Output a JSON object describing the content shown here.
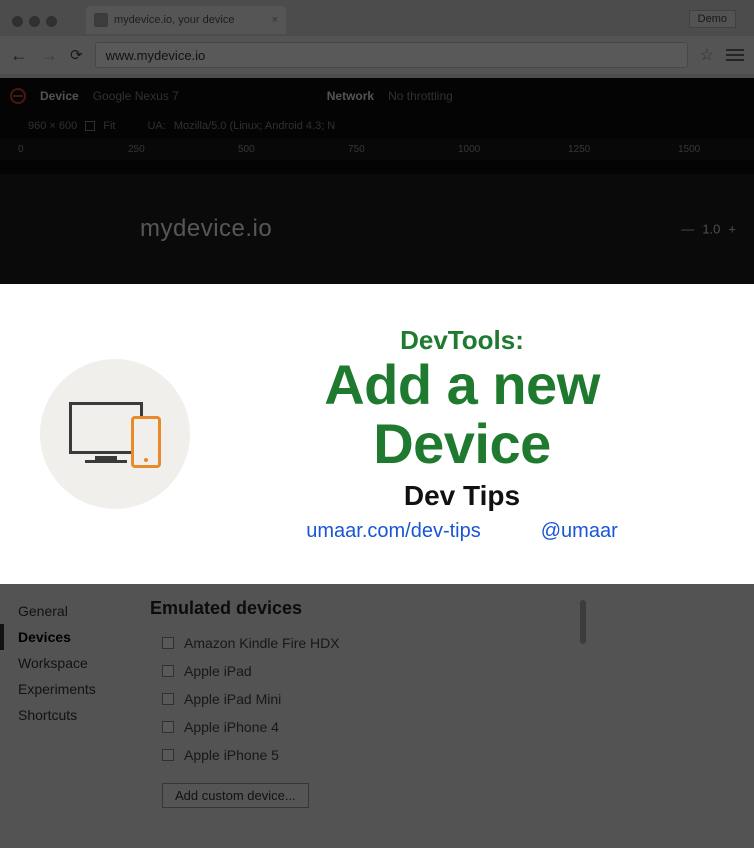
{
  "browser": {
    "tab_title": "mydevice.io, your device",
    "demo_label": "Demo",
    "url": "www.mydevice.io"
  },
  "dev_toolbar": {
    "device_label": "Device",
    "device_value": "Google Nexus 7",
    "network_label": "Network",
    "network_value": "No throttling",
    "dims": "960 × 600",
    "fit_label": "Fit",
    "ua_prefix": "UA:",
    "ua_value": "Mozilla/5.0 (Linux; Android 4.3; N",
    "ruler": [
      "0",
      "250",
      "500",
      "750",
      "1000",
      "1250",
      "1500"
    ]
  },
  "site": {
    "host": "mydevice.io",
    "zoom": "1.0"
  },
  "card": {
    "kicker": "DevTools:",
    "headline_l1": "Add a new",
    "headline_l2": "Device",
    "subtitle": "Dev Tips",
    "link_site": "umaar.com/dev-tips",
    "link_handle": "@umaar"
  },
  "settings": {
    "nav": [
      "General",
      "Devices",
      "Workspace",
      "Experiments",
      "Shortcuts"
    ],
    "active_index": 1,
    "heading": "Emulated devices",
    "devices": [
      "Amazon Kindle Fire HDX",
      "Apple iPad",
      "Apple iPad Mini",
      "Apple iPhone 4",
      "Apple iPhone 5"
    ],
    "add_button": "Add custom device..."
  }
}
